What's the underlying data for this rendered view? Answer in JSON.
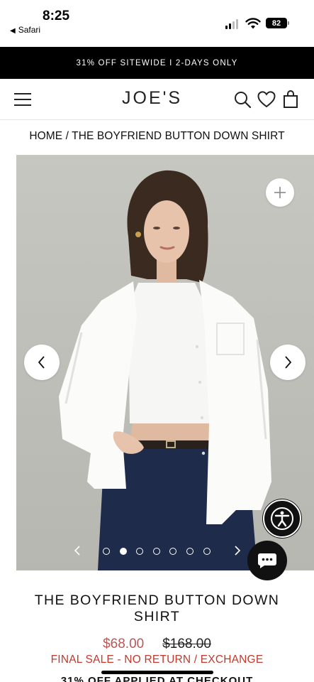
{
  "status_bar": {
    "time": "8:25",
    "back_app": "Safari",
    "battery": "82"
  },
  "promo_banner": {
    "text": "31% OFF SITEWIDE I 2-DAYS ONLY"
  },
  "header": {
    "logo": "JOE'S",
    "icons": [
      "menu-icon",
      "search-icon",
      "heart-icon",
      "bag-icon"
    ]
  },
  "breadcrumb": {
    "text": "HOME / THE BOYFRIEND BUTTON DOWN SHIRT"
  },
  "gallery": {
    "image_count": 7,
    "active_index": 1,
    "prev_label": "‹",
    "next_label": "›"
  },
  "product": {
    "title": "THE BOYFRIEND BUTTON DOWN SHIRT",
    "sale_price": "$68.00",
    "original_price": "$168.00",
    "final_sale": "FINAL SALE - NO RETURN / EXCHANGE",
    "promo_line": "31% OFF APPLIED AT CHECKOUT"
  },
  "colors": {
    "banner_bg": "#000000",
    "sale_price": "#b85858",
    "final_sale": "#c0392b"
  }
}
